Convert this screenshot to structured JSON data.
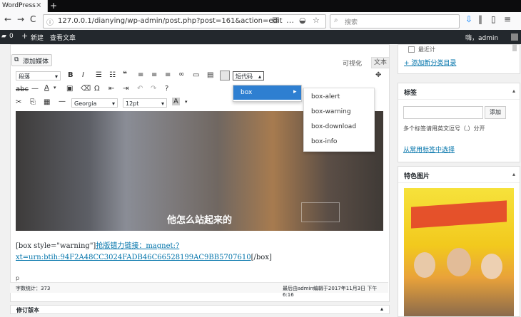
{
  "browser": {
    "tab_title": "WordPress",
    "tab_close": "×",
    "new_tab": "+",
    "back": "←",
    "forward": "→",
    "reload": "C",
    "home": "⌂",
    "url": "127.0.0.1/dianying/wp-admin/post.php?post=161&action=edit",
    "search_placeholder": "搜索"
  },
  "adminbar": {
    "comments_count": "0",
    "new_label": "新建",
    "view_post_label": "查看文章",
    "greeting": "嗨，admin"
  },
  "editor": {
    "add_media_label": "添加媒体",
    "tab_visual": "可视化",
    "tab_text": "文本",
    "format_select": "段落",
    "font_select": "Georgia",
    "size_select": "12pt",
    "shortcode_button": "短代码",
    "image_caption": "他怎么站起来的",
    "content_prefix": "[box style=\"warning\"]",
    "content_link": "抢版错力链接：magnet:?xt=urn:btih:94F2A48CC3024FADB46C66528199AC9BB5707610",
    "content_suffix": "[/box]",
    "status_path": "p",
    "word_count": "字数统计：373",
    "last_edited": "最后由admin编辑于2017年11月3日 下午6:16",
    "revisions_label": "修订版本"
  },
  "shortcode_menu": {
    "box_label": "box",
    "submenu": [
      "box-alert",
      "box-warning",
      "box-download",
      "box-info"
    ]
  },
  "sidebar": {
    "category_cut_label": "最近计",
    "add_category_link": "+ 添加新分类目录",
    "tags_title": "标签",
    "add_tag_button": "添加",
    "tags_hint": "多个标签请用英文逗号（,）分开",
    "choose_tags_link": "从常用标签中选择",
    "featured_title": "特色图片"
  },
  "colors": {
    "accent": "#0073aa",
    "menu_highlight": "#2e7fd1",
    "adminbar": "#23282d"
  }
}
